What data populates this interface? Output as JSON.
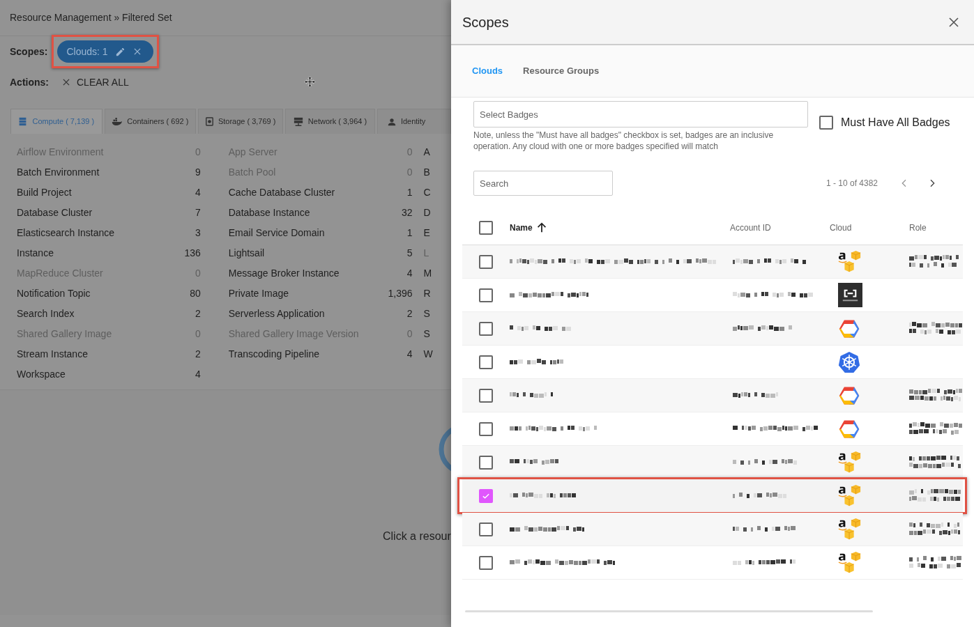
{
  "breadcrumb": "Resource Management » Filtered Set",
  "scopes": {
    "label": "Scopes:",
    "chips": [
      {
        "text": "Clouds: 1",
        "highlighted": true
      }
    ]
  },
  "actions": {
    "label": "Actions:",
    "buttons": [
      {
        "text": "CLEAR ALL"
      }
    ]
  },
  "resource_tabs": [
    {
      "label": "Compute ( 7,139 )",
      "selected": true,
      "kind": "compute"
    },
    {
      "label": "Containers ( 692 )",
      "selected": false,
      "kind": "containers"
    },
    {
      "label": "Storage ( 3,769 )",
      "selected": false,
      "kind": "storage"
    },
    {
      "label": "Network ( 3,964 )",
      "selected": false,
      "kind": "network"
    },
    {
      "label": "Identity",
      "selected": false,
      "kind": "identity"
    }
  ],
  "resource_columns": [
    [
      {
        "name": "Airflow Environment",
        "count": "0",
        "disabled": true
      },
      {
        "name": "Batch Environment",
        "count": "9",
        "disabled": false
      },
      {
        "name": "Build Project",
        "count": "4",
        "disabled": false
      },
      {
        "name": "Database Cluster",
        "count": "7",
        "disabled": false
      },
      {
        "name": "Elasticsearch Instance",
        "count": "3",
        "disabled": false
      },
      {
        "name": "Instance",
        "count": "136",
        "disabled": false
      },
      {
        "name": "MapReduce Cluster",
        "count": "0",
        "disabled": true
      },
      {
        "name": "Notification Topic",
        "count": "80",
        "disabled": false
      },
      {
        "name": "Search Index",
        "count": "2",
        "disabled": false
      },
      {
        "name": "Shared Gallery Image",
        "count": "0",
        "disabled": true
      },
      {
        "name": "Stream Instance",
        "count": "2",
        "disabled": false
      },
      {
        "name": "Workspace",
        "count": "4",
        "disabled": false
      }
    ],
    [
      {
        "name": "App Server",
        "count": "0",
        "disabled": true
      },
      {
        "name": "Batch Pool",
        "count": "0",
        "disabled": true
      },
      {
        "name": "Cache Database Cluster",
        "count": "1",
        "disabled": false
      },
      {
        "name": "Database Instance",
        "count": "32",
        "disabled": false
      },
      {
        "name": "Email Service Domain",
        "count": "1",
        "disabled": false
      },
      {
        "name": "Lightsail",
        "count": "5",
        "disabled": false
      },
      {
        "name": "Message Broker Instance",
        "count": "4",
        "disabled": false
      },
      {
        "name": "Private Image",
        "count": "1,396",
        "disabled": false
      },
      {
        "name": "Serverless Application",
        "count": "2",
        "disabled": false
      },
      {
        "name": "Shared Gallery Image Version",
        "count": "0",
        "disabled": true
      },
      {
        "name": "Transcoding Pipeline",
        "count": "4",
        "disabled": false
      }
    ],
    [
      {
        "name": "A",
        "disabled": false
      },
      {
        "name": "B",
        "disabled": false
      },
      {
        "name": "C",
        "disabled": false
      },
      {
        "name": "D",
        "disabled": false
      },
      {
        "name": "E",
        "disabled": false
      },
      {
        "name": "L",
        "disabled": true
      },
      {
        "name": "M",
        "disabled": false
      },
      {
        "name": "R",
        "disabled": false
      },
      {
        "name": "S",
        "disabled": false
      },
      {
        "name": "S",
        "disabled": false
      },
      {
        "name": "W",
        "disabled": false
      }
    ]
  ],
  "detail_hint": "Click a resour",
  "panel": {
    "title": "Scopes",
    "tabs": [
      {
        "label": "Clouds",
        "selected": true
      },
      {
        "label": "Resource Groups",
        "selected": false
      }
    ],
    "badges": {
      "placeholder": "Select Badges",
      "must_have_all": {
        "label": "Must Have All Badges",
        "checked": false
      },
      "note": "Note, unless the \"Must have all badges\" checkbox is set, badges are an inclusive operation. Any cloud with one or more badges specified will match"
    },
    "search": {
      "placeholder": "Search"
    },
    "pagination": "1 - 10 of 4382",
    "table": {
      "columns": [
        "Name",
        "Account ID",
        "Cloud",
        "Role"
      ],
      "all_checked": false,
      "rows": [
        {
          "selected": false,
          "highlighted": false,
          "kind": "aws",
          "has_role": true
        },
        {
          "selected": false,
          "highlighted": false,
          "kind": "alibaba",
          "has_role": false
        },
        {
          "selected": false,
          "highlighted": false,
          "kind": "gcp",
          "has_role": true
        },
        {
          "selected": false,
          "highlighted": false,
          "kind": "kubernetes",
          "has_role": false
        },
        {
          "selected": false,
          "highlighted": false,
          "kind": "gcp",
          "has_role": true
        },
        {
          "selected": false,
          "highlighted": false,
          "kind": "gcp",
          "has_role": true
        },
        {
          "selected": false,
          "highlighted": false,
          "kind": "aws",
          "has_role": true
        },
        {
          "selected": true,
          "highlighted": true,
          "kind": "aws",
          "has_role": true
        },
        {
          "selected": false,
          "highlighted": false,
          "kind": "aws",
          "has_role": true
        },
        {
          "selected": false,
          "highlighted": false,
          "kind": "aws",
          "has_role": true
        }
      ]
    }
  }
}
